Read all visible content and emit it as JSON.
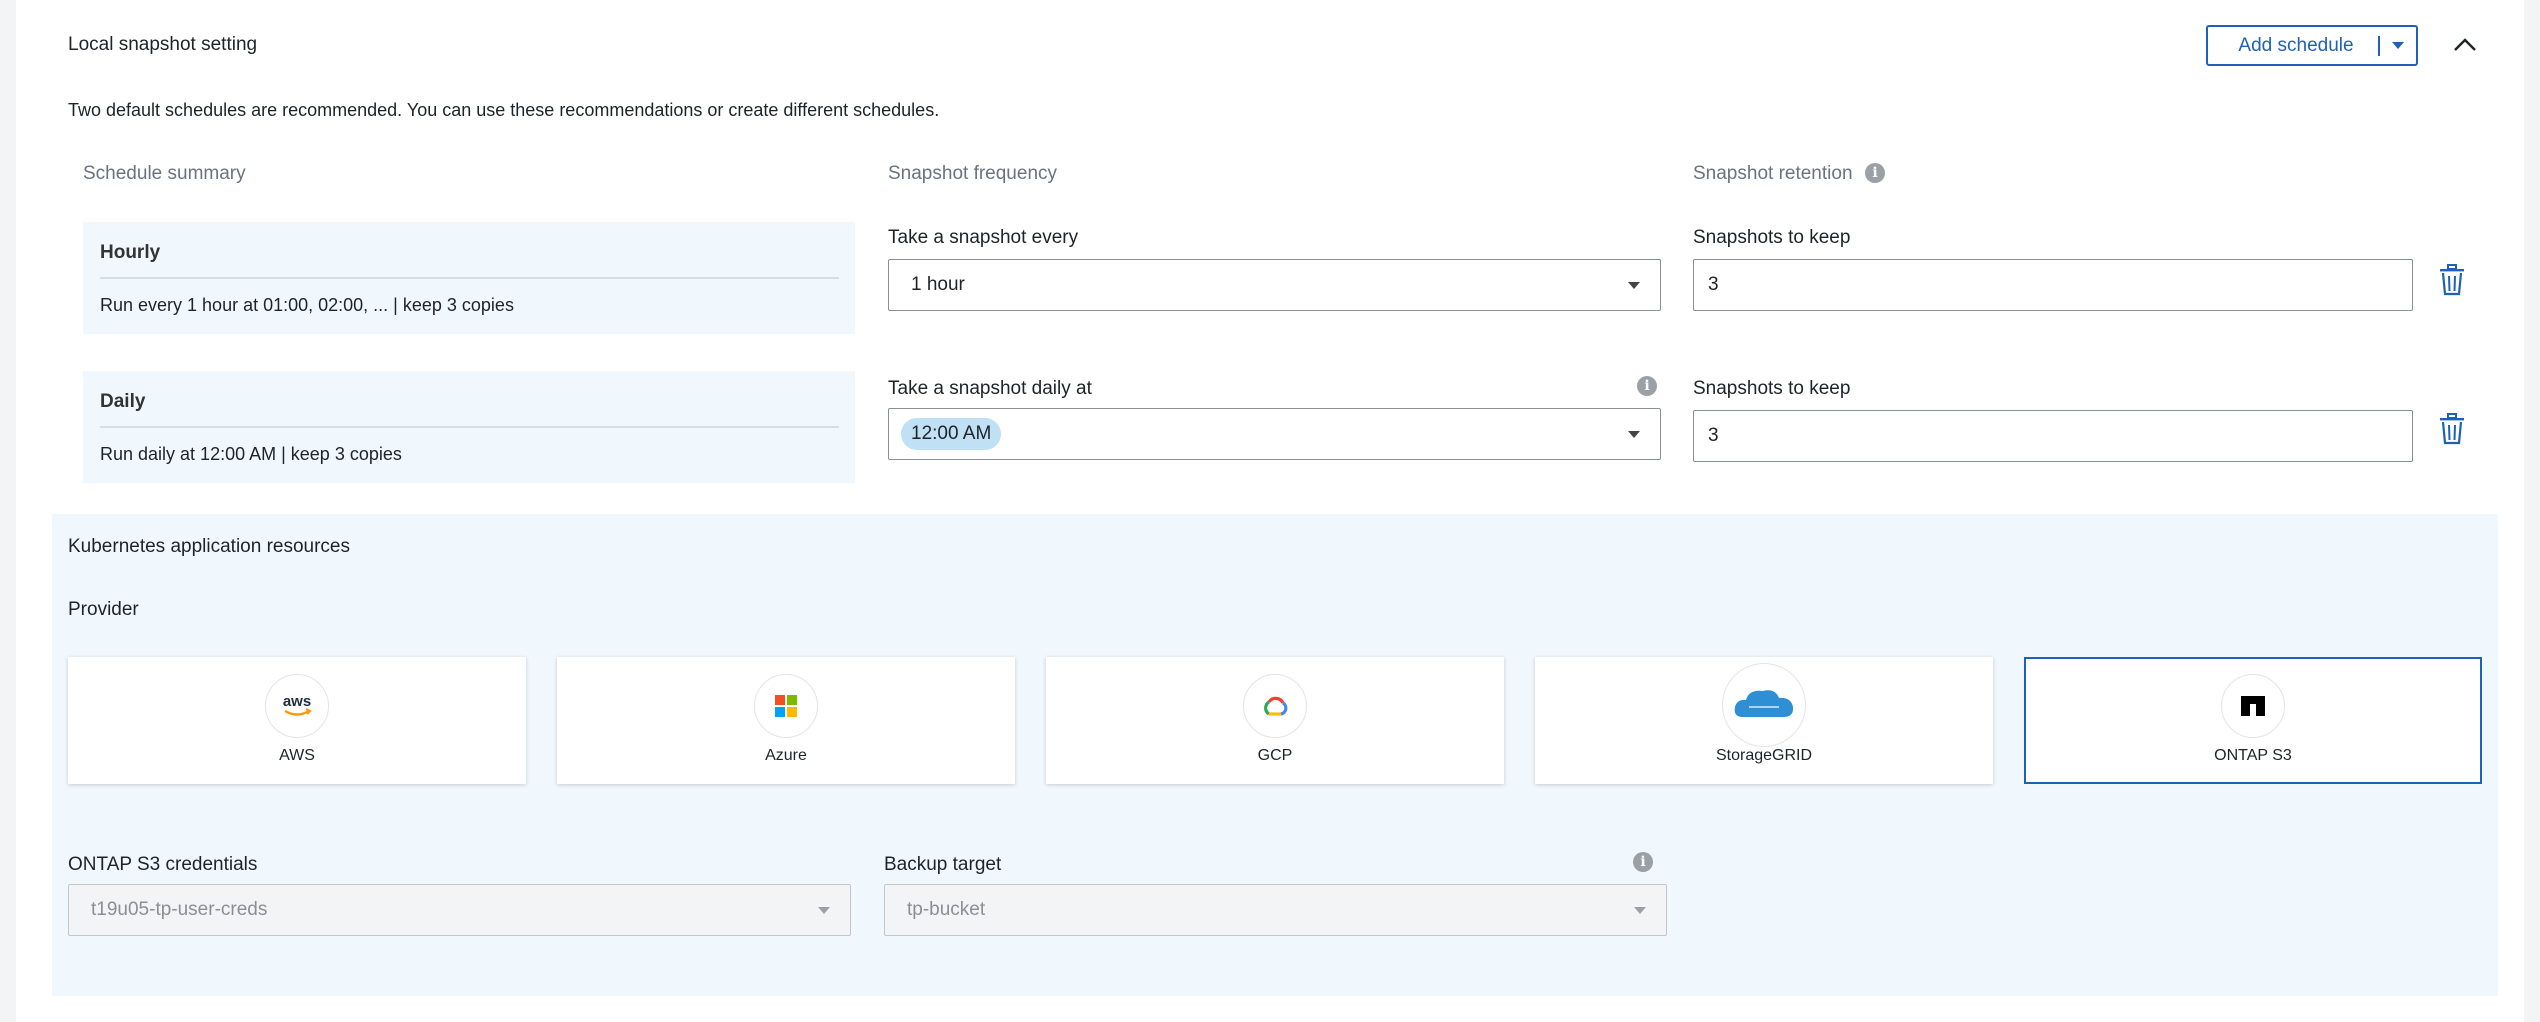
{
  "snapshot": {
    "title": "Local snapshot setting",
    "add_schedule_label": "Add schedule",
    "description": "Two default schedules are recommended. You can use these recommendations or create different schedules.",
    "columns": {
      "summary": "Schedule summary",
      "frequency": "Snapshot frequency",
      "retention": "Snapshot retention"
    },
    "schedules": [
      {
        "name": "Hourly",
        "summary": "Run every 1 hour at 01:00, 02:00, ... | keep 3 copies",
        "frequency_label": "Take a snapshot every",
        "frequency_value": "1 hour",
        "retention_label": "Snapshots to keep",
        "retention_value": "3"
      },
      {
        "name": "Daily",
        "summary": "Run daily at 12:00 AM | keep 3 copies",
        "frequency_label": "Take a snapshot daily at",
        "frequency_value": "12:00 AM",
        "retention_label": "Snapshots to keep",
        "retention_value": "3"
      }
    ]
  },
  "kubernetes": {
    "title": "Kubernetes application resources",
    "provider_label": "Provider",
    "providers": [
      {
        "name": "AWS",
        "icon": "aws-logo-icon",
        "selected": false
      },
      {
        "name": "Azure",
        "icon": "azure-logo-icon",
        "selected": false
      },
      {
        "name": "GCP",
        "icon": "gcp-logo-icon",
        "selected": false
      },
      {
        "name": "StorageGRID",
        "icon": "storagegrid-logo-icon",
        "selected": false
      },
      {
        "name": "ONTAP S3",
        "icon": "ontap-logo-icon",
        "selected": true
      }
    ],
    "credentials_label": "ONTAP S3 credentials",
    "credentials_value": "t19u05-tp-user-creds",
    "backup_target_label": "Backup target",
    "backup_target_value": "tp-bucket"
  },
  "colors": {
    "accent": "#1d62b8",
    "panel_bg": "#f1f8fd",
    "chip_bg": "#bfe0f5"
  }
}
